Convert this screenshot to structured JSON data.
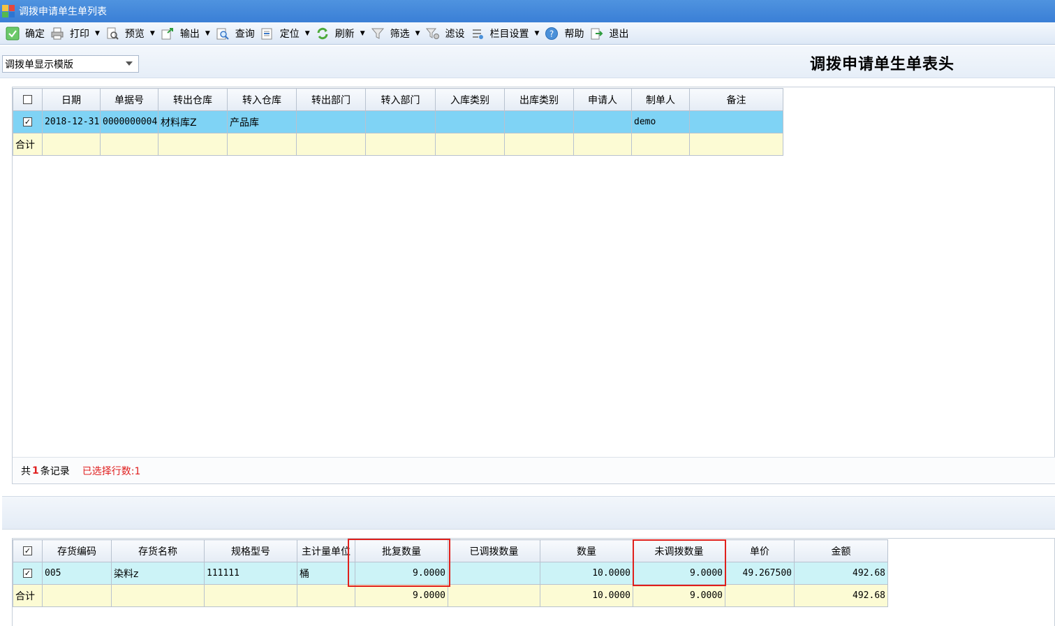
{
  "window": {
    "title": "调拨申请单生单列表"
  },
  "toolbar": [
    {
      "label": "确定",
      "icon": "confirm-icon",
      "dropdown": false
    },
    {
      "label": "打印",
      "icon": "print-icon",
      "dropdown": true
    },
    {
      "label": "预览",
      "icon": "preview-icon",
      "dropdown": true
    },
    {
      "label": "输出",
      "icon": "export-icon",
      "dropdown": true
    },
    {
      "label": "查询",
      "icon": "query-icon",
      "dropdown": false
    },
    {
      "label": "定位",
      "icon": "locate-icon",
      "dropdown": true
    },
    {
      "label": "刷新",
      "icon": "refresh-icon",
      "dropdown": true
    },
    {
      "label": "筛选",
      "icon": "filter-icon",
      "dropdown": true
    },
    {
      "label": "滤设",
      "icon": "filter-settings-icon",
      "dropdown": false
    },
    {
      "label": "栏目设置",
      "icon": "column-settings-icon",
      "dropdown": true
    },
    {
      "label": "帮助",
      "icon": "help-icon",
      "dropdown": false
    },
    {
      "label": "退出",
      "icon": "exit-icon",
      "dropdown": false
    }
  ],
  "template_select": {
    "value": "调拨单显示模版"
  },
  "heading": "调拨申请单生单表头",
  "header_grid": {
    "columns": [
      "日期",
      "单据号",
      "转出仓库",
      "转入仓库",
      "转出部门",
      "转入部门",
      "入库类别",
      "出库类别",
      "申请人",
      "制单人",
      "备注"
    ],
    "rows": [
      {
        "checked": true,
        "cells": [
          "2018-12-31",
          "0000000004",
          "材料库Z",
          "产品库",
          "",
          "",
          "",
          "",
          "",
          "demo",
          ""
        ]
      }
    ],
    "total_label": "合计",
    "totals": [
      "",
      "",
      "",
      "",
      "",
      "",
      "",
      "",
      "",
      "",
      ""
    ]
  },
  "status": {
    "prefix": "共",
    "count": "1",
    "suffix": "条记录",
    "selected": "已选择行数:1"
  },
  "body_grid": {
    "columns": [
      "存货编码",
      "存货名称",
      "规格型号",
      "主计量单位",
      "批复数量",
      "已调拨数量",
      "数量",
      "未调拨数量",
      "单价",
      "金额"
    ],
    "rows": [
      {
        "checked": true,
        "cells": [
          "005",
          "染料z",
          "111111",
          "桶",
          "9.0000",
          "",
          "10.0000",
          "9.0000",
          "49.267500",
          "492.68"
        ]
      }
    ],
    "total_label": "合计",
    "totals": [
      "",
      "",
      "",
      "",
      "9.0000",
      "",
      "10.0000",
      "9.0000",
      "",
      "492.68"
    ]
  },
  "colors": {
    "titlebar": "#3a7fd6",
    "selected_row": "#7fd3f5",
    "total_row": "#fcfbd4",
    "highlight": "#e0201c",
    "status_red": "#e02020"
  }
}
